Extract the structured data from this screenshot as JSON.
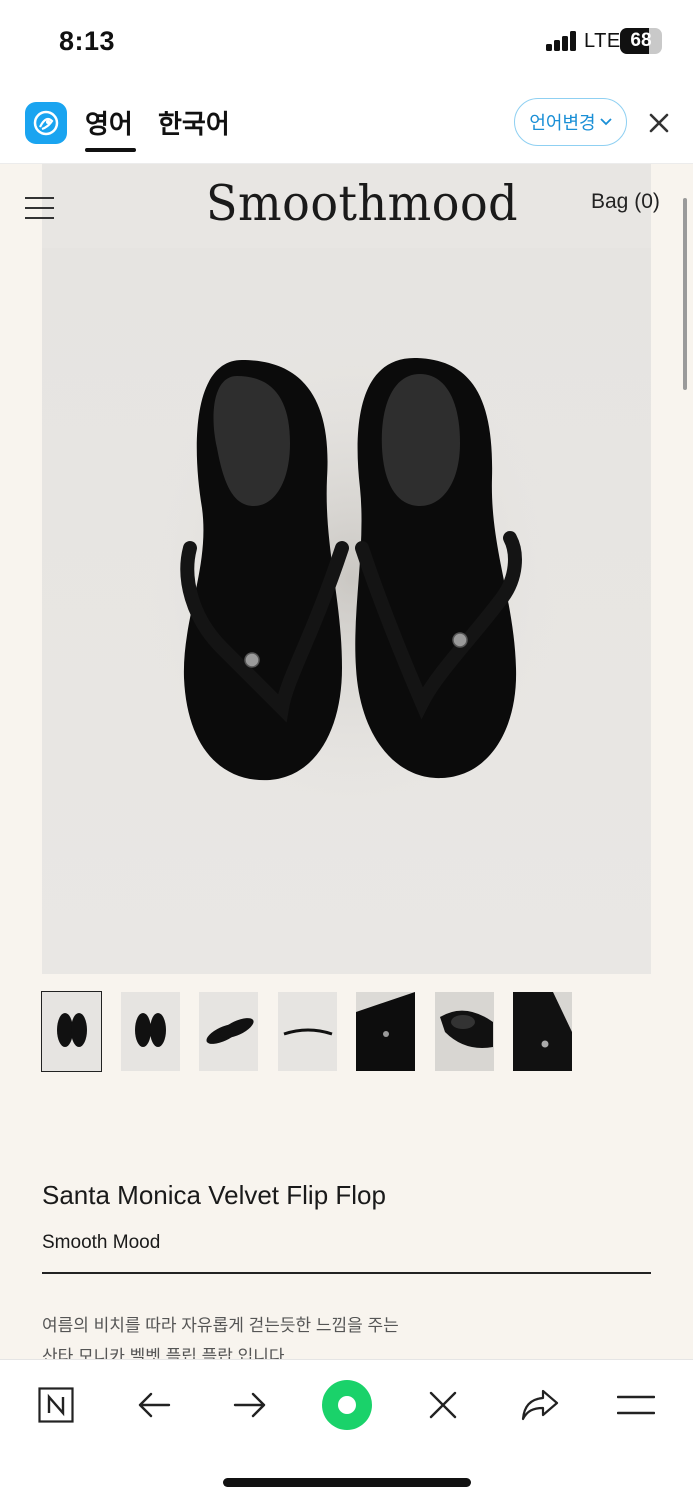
{
  "status_bar": {
    "time": "8:13",
    "network": "LTE",
    "battery_level": "68",
    "battery_fraction": 0.68
  },
  "translate_bar": {
    "logo_icon": "papago-icon",
    "tabs": [
      {
        "label": "영어",
        "active": true
      },
      {
        "label": "한국어",
        "active": false
      }
    ],
    "change_language_label": "언어변경",
    "accent_color": "#1a8fd6"
  },
  "site_header": {
    "logo": "Smoothmood",
    "bag_label": "Bag (0)"
  },
  "product": {
    "title": "Santa Monica Velvet Flip Flop",
    "brand": "Smooth Mood",
    "description_lines": [
      "여름의 비치를 따라 자유롭게 걷는듯한 느낌을 주는",
      "산타 모니카 벨벳 플립 플랍 입니다"
    ],
    "thumbnail_count": 7,
    "selected_thumbnail": 1
  },
  "toolbar": {
    "icons": [
      "naver-icon",
      "back-arrow-icon",
      "forward-arrow-icon",
      "green-dot-icon",
      "close-icon",
      "share-icon",
      "menu-icon"
    ],
    "green_color": "#1ad26a"
  }
}
